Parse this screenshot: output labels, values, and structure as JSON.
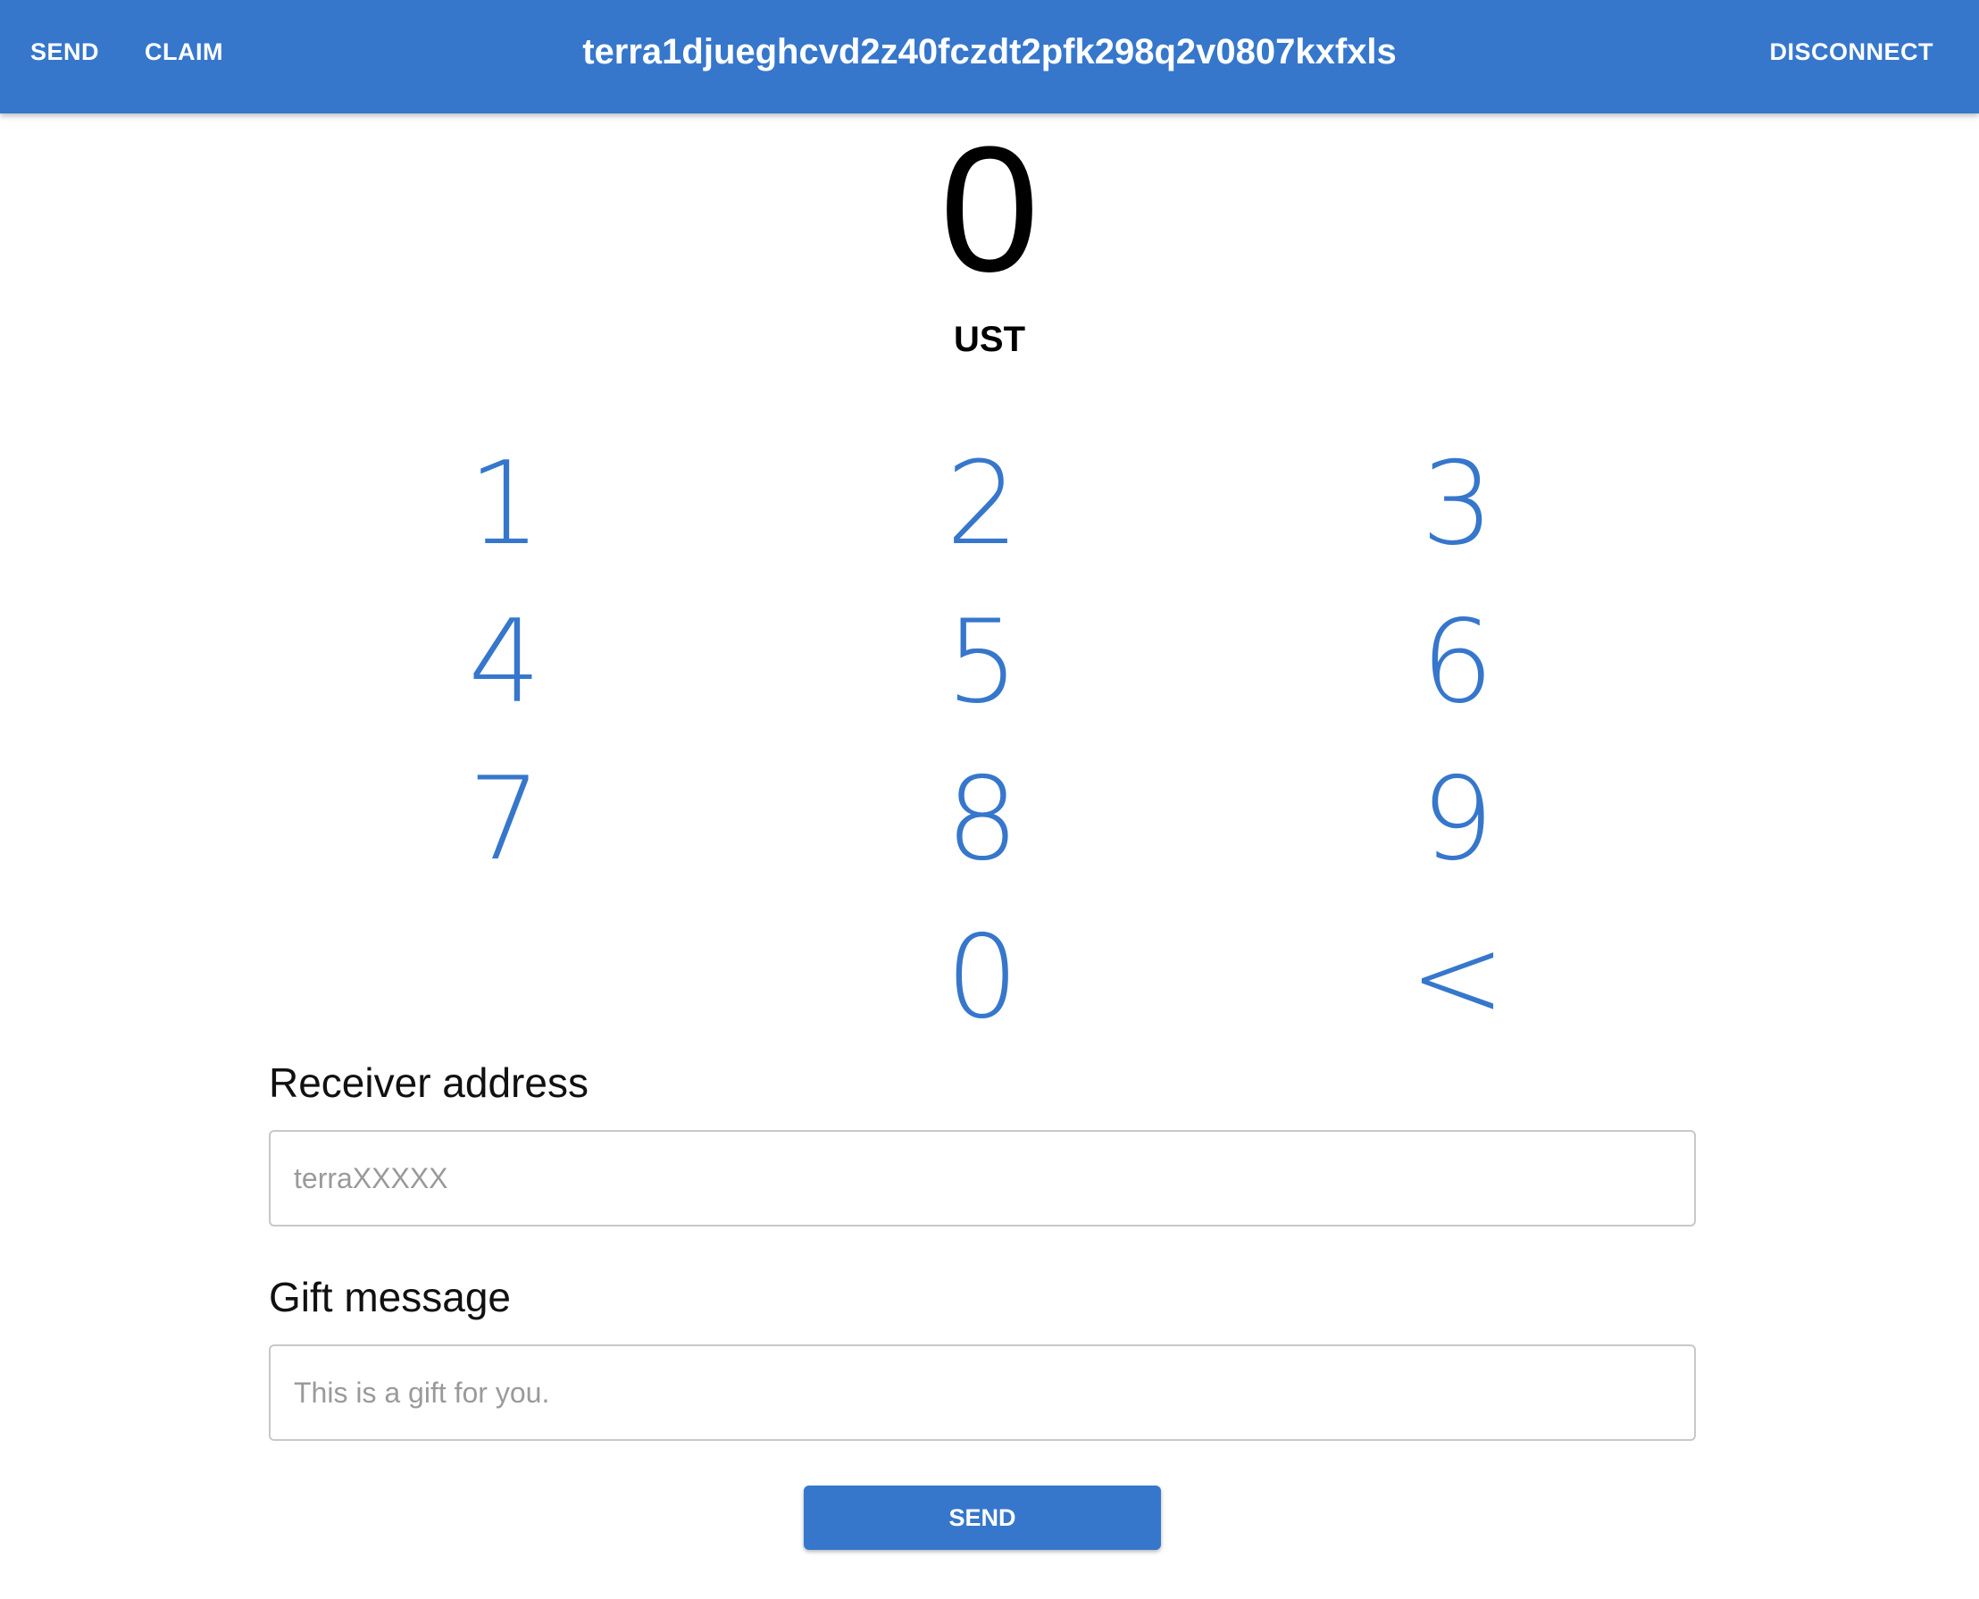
{
  "header": {
    "nav_send": "SEND",
    "nav_claim": "CLAIM",
    "address": "terra1djueghcvd2z40fczdt2pfk298q2v0807kxfxls",
    "disconnect": "DISCONNECT"
  },
  "amount": {
    "value": "0",
    "unit": "UST"
  },
  "keypad": {
    "k1": "1",
    "k2": "2",
    "k3": "3",
    "k4": "4",
    "k5": "5",
    "k6": "6",
    "k7": "7",
    "k8": "8",
    "k9": "9",
    "k0": "0",
    "back": "<"
  },
  "form": {
    "receiver_label": "Receiver address",
    "receiver_placeholder": "terraXXXXX",
    "gift_label": "Gift message",
    "gift_placeholder": "This is a gift for you.",
    "send_label": "SEND"
  },
  "colors": {
    "primary": "#3677CC"
  }
}
